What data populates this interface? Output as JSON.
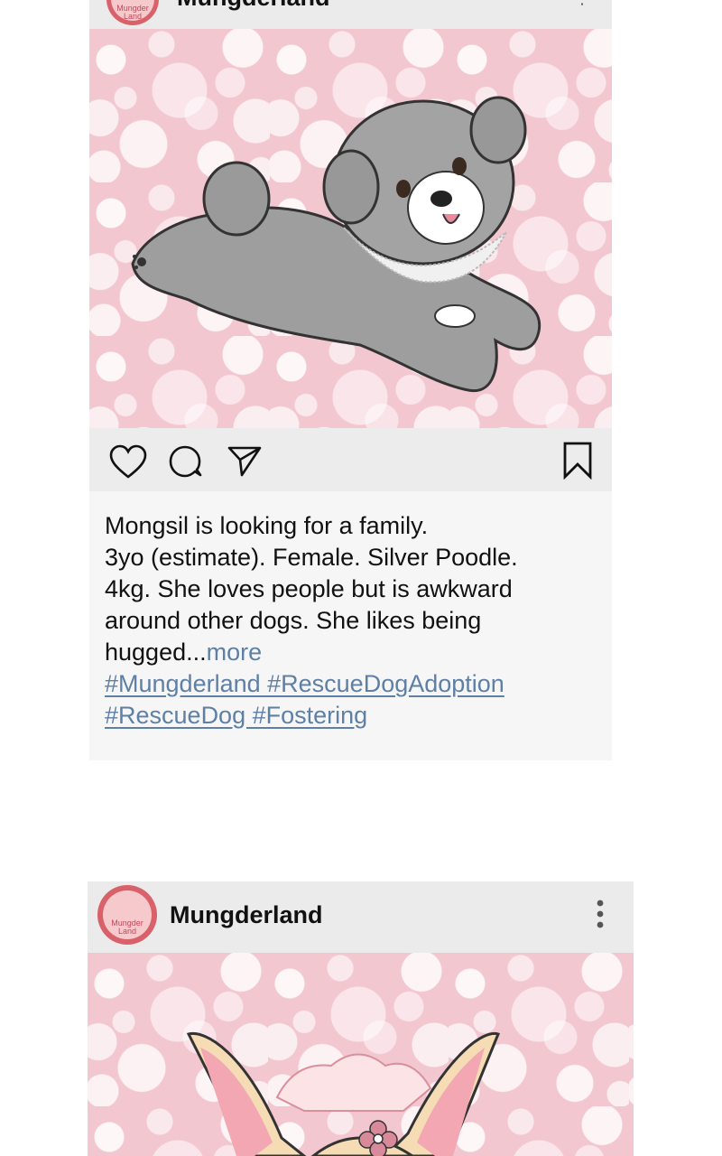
{
  "post1": {
    "username": "Mungderland",
    "avatar_text": [
      "Mungder",
      "Land"
    ],
    "caption_lines": [
      "Mongsil is looking for a family.",
      "3yo (estimate). Female. Silver Poodle.",
      "4kg. She loves people but is awkward",
      "around other dogs. She likes being"
    ],
    "caption_last": "hugged...",
    "more_label": "more",
    "hashtags_line1": "#Mungderland #RescueDogAdoption",
    "hashtags_line2": "#RescueDog #Fostering",
    "icons": [
      "heart-icon",
      "comment-icon",
      "share-icon",
      "bookmark-icon",
      "more-options-icon"
    ]
  },
  "post2": {
    "username": "Mungderland",
    "avatar_text": [
      "Mungder",
      "Land"
    ],
    "icons": [
      "more-options-icon"
    ]
  },
  "colors": {
    "hashtag": "#5e7fa6",
    "action_bar": "#ececec",
    "caption_bg": "#f6f6f6",
    "avatar_ring": "#d9626a",
    "image_bg": "#f3c7d0"
  }
}
